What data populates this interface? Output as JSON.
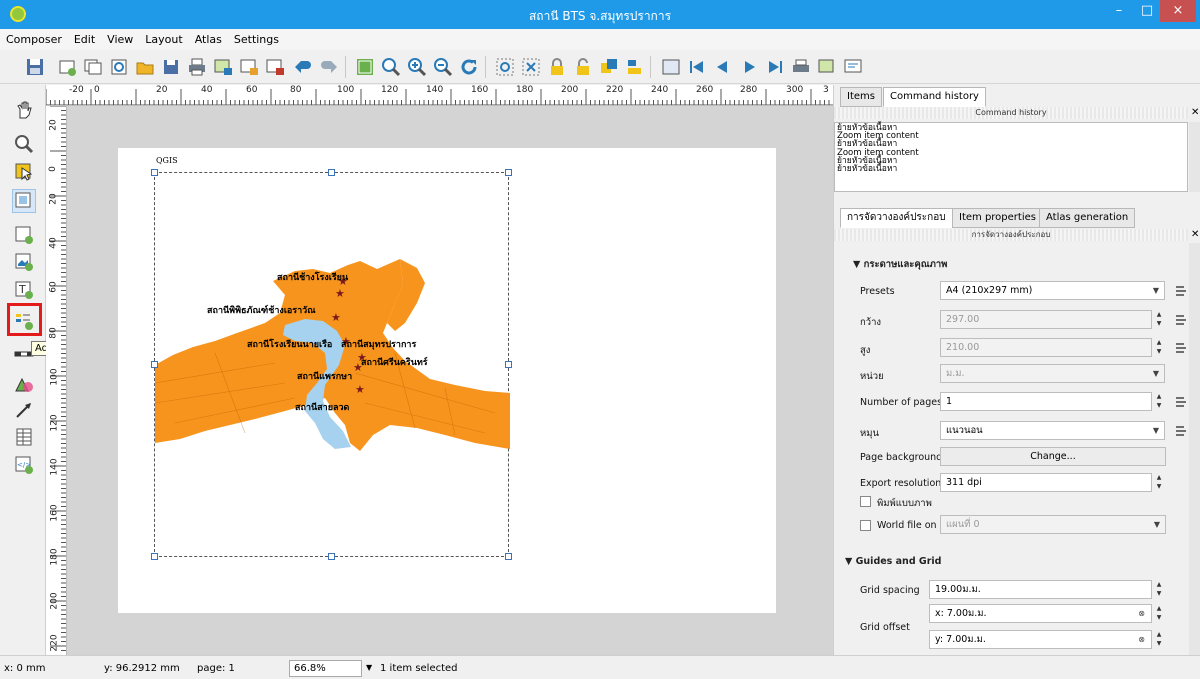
{
  "window": {
    "title": "สถานี BTS จ.สมุทรปราการ",
    "minimize": "–",
    "maximize": "□",
    "close": "×"
  },
  "menu": [
    "Composer",
    "Edit",
    "View",
    "Layout",
    "Atlas",
    "Settings"
  ],
  "ruler": {
    "h": [
      "-20",
      "0",
      "20",
      "40",
      "60",
      "80",
      "100",
      "120",
      "140",
      "160",
      "180",
      "200",
      "220",
      "240",
      "260",
      "280",
      "300",
      "3"
    ],
    "v": [
      "20",
      "0",
      "20",
      "40",
      "60",
      "80",
      "100",
      "120",
      "140",
      "160",
      "180",
      "200",
      "220"
    ]
  },
  "tooltip": "Add new legend",
  "composition": {
    "label": "QGIS",
    "stations": [
      "สถานีช้างโรงเรียน",
      "สถานีพิพิธภัณฑ์ช้างเอราวัณ",
      "สถานีโรงเรียนนายเรือ",
      "สถานีสมุทรปราการ",
      "สถานีศรีนครินทร์",
      "สถานีแพรกษา",
      "สถานีสายลวด"
    ]
  },
  "tabs_top": [
    "Items",
    "Command history"
  ],
  "history": {
    "header": "Command history",
    "entries": [
      "ย้ายหัวข้อเนื้อหา",
      "Zoom item content",
      "ย้ายหัวข้อเนื้อหา",
      "Zoom item content",
      "ย้ายหัวข้อเนื้อหา",
      "ย้ายหัวข้อเนื้อหา"
    ]
  },
  "tabs_bottom": [
    "การจัดวางองค์ประกอบ",
    "Item properties",
    "Atlas generation"
  ],
  "composition_panel": {
    "header": "การจัดวางองค์ประกอบ",
    "section_paper": "กระดาษและคุณภาพ",
    "presets_label": "Presets",
    "presets_value": "A4 (210x297 mm)",
    "width_label": "กว้าง",
    "width_value": "297.00",
    "height_label": "สูง",
    "height_value": "210.00",
    "units_label": "หน่วย",
    "units_value": "ม.ม.",
    "pages_label": "Number of pages",
    "pages_value": "1",
    "orient_label": "หมุน",
    "orient_value": "แนวนอน",
    "bg_label": "Page background",
    "bg_button": "Change...",
    "res_label": "Export resolution",
    "res_value": "311 dpi",
    "raster_label": "พิมพ์แบบภาพ",
    "world_label": "World file on",
    "world_value": "แผนที่ 0",
    "section_grid": "Guides and Grid",
    "spacing_label": "Grid spacing",
    "spacing_value": "19.00ม.ม.",
    "offset_label": "Grid offset",
    "offset_x": "x: 7.00ม.ม.",
    "offset_y": "y: 7.00ม.ม."
  },
  "status": {
    "x": "x: 0 mm",
    "y": "y: 96.2912 mm",
    "page": "page: 1",
    "zoom": "66.8%",
    "selected": "1 item selected"
  },
  "colors": {
    "titlebar": "#1f9ae8",
    "map_land": "#f7941d",
    "river": "#a6d2ef",
    "highlight": "#e41b1b"
  }
}
